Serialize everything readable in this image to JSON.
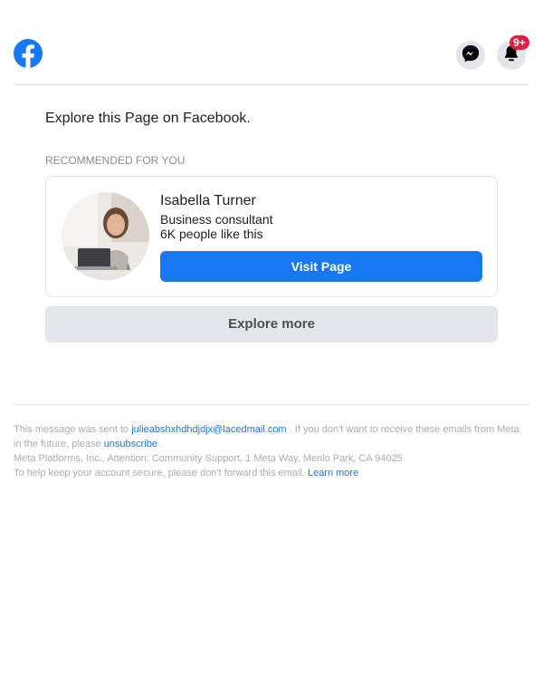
{
  "header": {
    "logo_icon": "facebook-logo-icon",
    "messenger_icon": "messenger-icon",
    "notifications_icon": "bell-icon",
    "notification_badge": "9+"
  },
  "main": {
    "heading": "Explore this Page on Facebook.",
    "section_label": "RECOMMENDED FOR YOU",
    "card": {
      "name": "Isabella Turner",
      "category": "Business consultant",
      "likes": "6K people like this",
      "visit_label": "Visit Page",
      "avatar_icon": "profile-photo"
    },
    "explore_more_label": "Explore more"
  },
  "footer": {
    "line1_prefix": "This message was sent to ",
    "email": "julieabshxhdhdjdjx@lacedmail.com",
    "line1_middle": " . If you don't want to receive these emails from Meta in the future, please ",
    "unsubscribe_label": "unsubscribe",
    "line1_suffix": " .",
    "address": "Meta Platforms, Inc., Attention: Community Support, 1 Meta Way, Menlo Park, CA 94025",
    "security_text": "To help keep your account secure, please don't forward this email. ",
    "learn_more_label": "Learn more"
  },
  "colors": {
    "brand_blue": "#1877f2",
    "badge_red": "#e41e3f",
    "secondary_button": "#e4e6eb",
    "muted_text": "#8a8d91"
  }
}
